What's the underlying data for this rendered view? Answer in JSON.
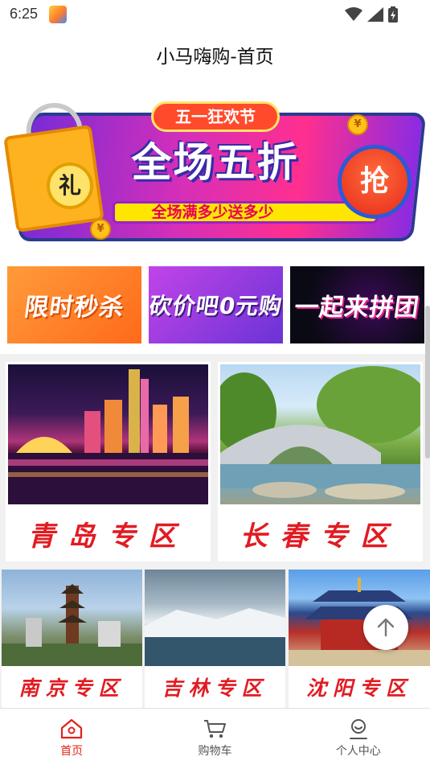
{
  "status_bar": {
    "time": "6:25",
    "icons": [
      "app-notification-icon",
      "wifi-icon",
      "cellular-signal-icon",
      "battery-charging-icon"
    ]
  },
  "header": {
    "title": "小马嗨购-首页"
  },
  "banner": {
    "tag": "五一狂欢节",
    "headline": "全场五折",
    "subline": "全场满多少送多少",
    "gift_char": "礼",
    "grab_char": "抢",
    "coin_char": "¥"
  },
  "promos": [
    {
      "label": "限时秒杀"
    },
    {
      "label": "砍价吧0元购"
    },
    {
      "label": "一起来拼团"
    }
  ],
  "zones_featured": [
    {
      "label": "青岛专区"
    },
    {
      "label": "长春专区"
    }
  ],
  "zones_more": [
    {
      "label": "南京专区"
    },
    {
      "label": "吉林专区"
    },
    {
      "label": "沈阳专区"
    }
  ],
  "tab_bar": {
    "items": [
      {
        "label": "首页",
        "icon": "home-icon",
        "active": true
      },
      {
        "label": "购物车",
        "icon": "cart-icon",
        "active": false
      },
      {
        "label": "个人中心",
        "icon": "profile-icon",
        "active": false
      }
    ]
  },
  "colors": {
    "accent": "#e2231a",
    "zone_label": "#e21b22",
    "divider": "#f1f1f1"
  }
}
